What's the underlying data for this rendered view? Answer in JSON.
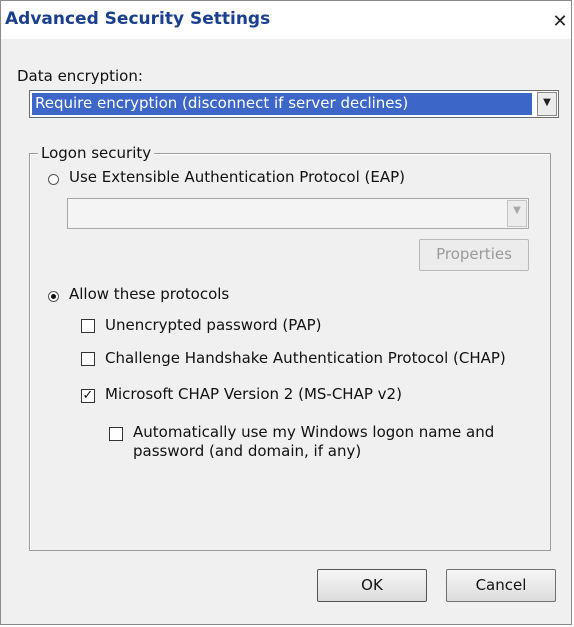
{
  "dialog": {
    "title": "Advanced Security Settings",
    "close_glyph": "✕"
  },
  "data_encryption": {
    "label": "Data encryption:",
    "selected": "Require encryption (disconnect if server declines)"
  },
  "logon_security": {
    "legend": "Logon security",
    "eap_radio_label": "Use Extensible Authentication Protocol (EAP)",
    "eap_radio_checked": false,
    "eap_select_value": "",
    "properties_label": "Properties",
    "allow_radio_label": "Allow these protocols",
    "allow_radio_checked": true,
    "protocols": [
      {
        "label": "Unencrypted password (PAP)",
        "checked": false
      },
      {
        "label": "Challenge Handshake Authentication Protocol (CHAP)",
        "checked": false
      },
      {
        "label": "Microsoft CHAP Version 2 (MS-CHAP v2)",
        "checked": true
      }
    ],
    "auto_logon_label_line1": "Automatically use my Windows logon name and",
    "auto_logon_label_line2": "password (and domain, if any)",
    "auto_logon_checked": false
  },
  "footer": {
    "ok_label": "OK",
    "cancel_label": "Cancel"
  },
  "icons": {
    "dropdown": "▼",
    "check": "✓"
  }
}
